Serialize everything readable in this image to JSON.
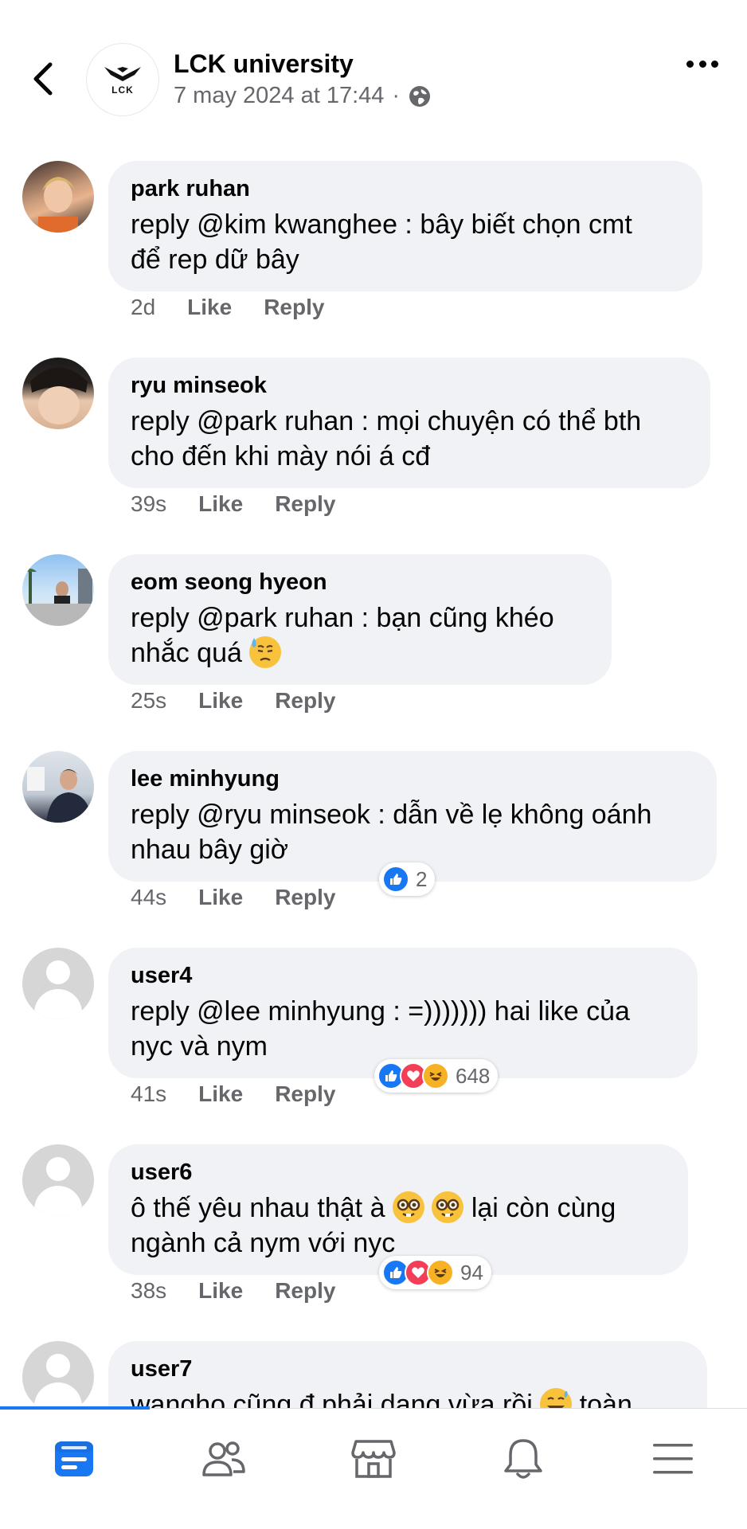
{
  "header": {
    "page_name": "LCK university",
    "logo_text": "LCK",
    "timestamp": "7 may 2024 at 17:44",
    "separator": "·"
  },
  "comments": [
    {
      "name": "park ruhan",
      "text_line1": "reply @kim kwanghee : bây biết chọn cmt",
      "text_line2": "để rep dữ bây",
      "time": "2d",
      "like": "Like",
      "reply": "Reply"
    },
    {
      "name": "ryu minseok",
      "text_line1": "reply @park ruhan : mọi chuyện có thể bth",
      "text_line2": "cho đến khi mày nói á cđ",
      "time": "39s",
      "like": "Like",
      "reply": "Reply"
    },
    {
      "name": "eom seong hyeon",
      "text_line1": "reply @park ruhan : bạn cũng khéo",
      "text_line2": "nhắc quá",
      "time": "25s",
      "like": "Like",
      "reply": "Reply"
    },
    {
      "name": "lee minhyung",
      "text_line1": "reply @ryu minseok : dẫn về lẹ không oánh",
      "text_line2": "nhau bây giờ",
      "time": "44s",
      "like": "Like",
      "reply": "Reply",
      "reaction_count": "2"
    },
    {
      "name": "user4",
      "text_line1": "reply @lee minhyung : =))))))) hai like của",
      "text_line2": "nyc và nym",
      "time": "41s",
      "like": "Like",
      "reply": "Reply",
      "reaction_count": "648"
    },
    {
      "name": "user6",
      "text_line1a": "ô thế yêu nhau thật à",
      "text_line1b": "lại còn cùng",
      "text_line2": "ngành cả nym với nyc",
      "time": "38s",
      "like": "Like",
      "reply": "Reply",
      "reaction_count": "94"
    },
    {
      "name": "user7",
      "text_line1a": "wangho cũng đ phải dạng vừa rồi",
      "text_line1b": "toàn"
    }
  ],
  "colors": {
    "accent": "#1877f2",
    "bubble": "#f0f2f5",
    "secondary_text": "#65676b",
    "love": "#f33e58",
    "haha": "#f7b125"
  },
  "icons": {
    "back": "chevron-left-icon",
    "globe": "globe-icon",
    "more": "more-dots-icon",
    "nav": [
      "feed-icon",
      "friends-icon",
      "marketplace-icon",
      "bell-icon",
      "menu-icon"
    ]
  }
}
